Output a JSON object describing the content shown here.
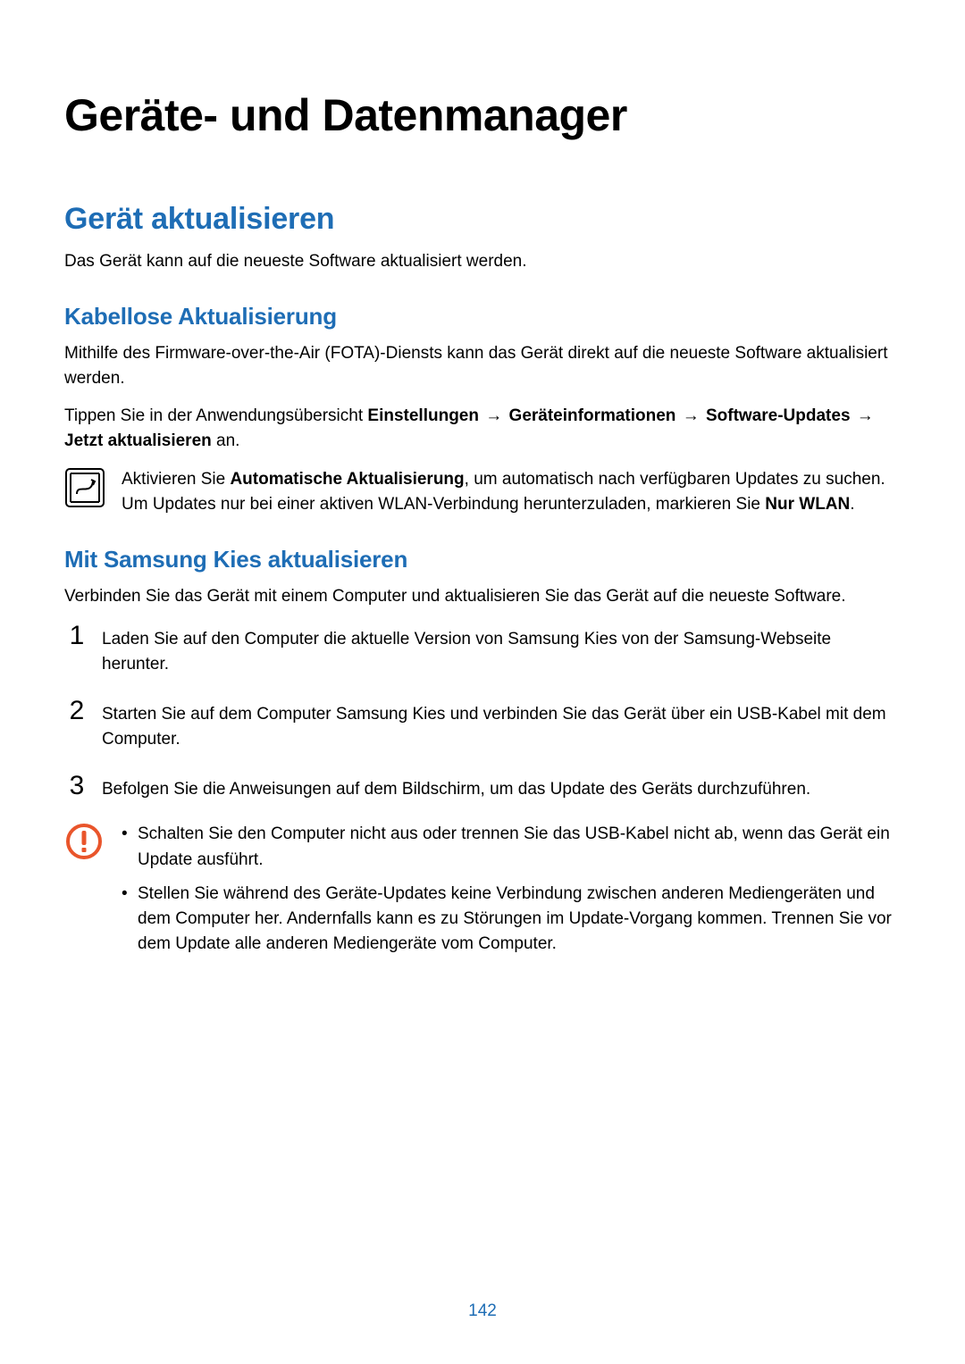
{
  "page_number": "142",
  "title": "Geräte- und Datenmanager",
  "section1": {
    "heading": "Gerät aktualisieren",
    "intro": "Das Gerät kann auf die neueste Software aktualisiert werden.",
    "sub1": {
      "heading": "Kabellose Aktualisierung",
      "p1": "Mithilfe des Firmware-over-the-Air (FOTA)-Diensts kann das Gerät direkt auf die neueste Software aktualisiert werden.",
      "p2_pre": "Tippen Sie in der Anwendungsübersicht ",
      "p2_b1": "Einstellungen",
      "p2_arrow1": " → ",
      "p2_b2": "Geräteinformationen",
      "p2_arrow2": " → ",
      "p2_b3": "Software-Updates",
      "p2_arrow3": " → ",
      "p2_b4": "Jetzt aktualisieren",
      "p2_post": " an.",
      "note_pre": "Aktivieren Sie ",
      "note_b1": "Automatische Aktualisierung",
      "note_mid": ", um automatisch nach verfügbaren Updates zu suchen. Um Updates nur bei einer aktiven WLAN-Verbindung herunterzuladen, markieren Sie ",
      "note_b2": "Nur WLAN",
      "note_post": "."
    },
    "sub2": {
      "heading": "Mit Samsung Kies aktualisieren",
      "intro": "Verbinden Sie das Gerät mit einem Computer und aktualisieren Sie das Gerät auf die neueste Software.",
      "step1_num": "1",
      "step1": "Laden Sie auf den Computer die aktuelle Version von Samsung Kies von der Samsung-Webseite herunter.",
      "step2_num": "2",
      "step2": "Starten Sie auf dem Computer Samsung Kies und verbinden Sie das Gerät über ein USB-Kabel mit dem Computer.",
      "step3_num": "3",
      "step3": "Befolgen Sie die Anweisungen auf dem Bildschirm, um das Update des Geräts durchzuführen.",
      "caution1": "Schalten Sie den Computer nicht aus oder trennen Sie das USB-Kabel nicht ab, wenn das Gerät ein Update ausführt.",
      "caution2": "Stellen Sie während des Geräte-Updates keine Verbindung zwischen anderen Mediengeräten und dem Computer her. Andernfalls kann es zu Störungen im Update-Vorgang kommen. Trennen Sie vor dem Update alle anderen Mediengeräte vom Computer."
    }
  }
}
